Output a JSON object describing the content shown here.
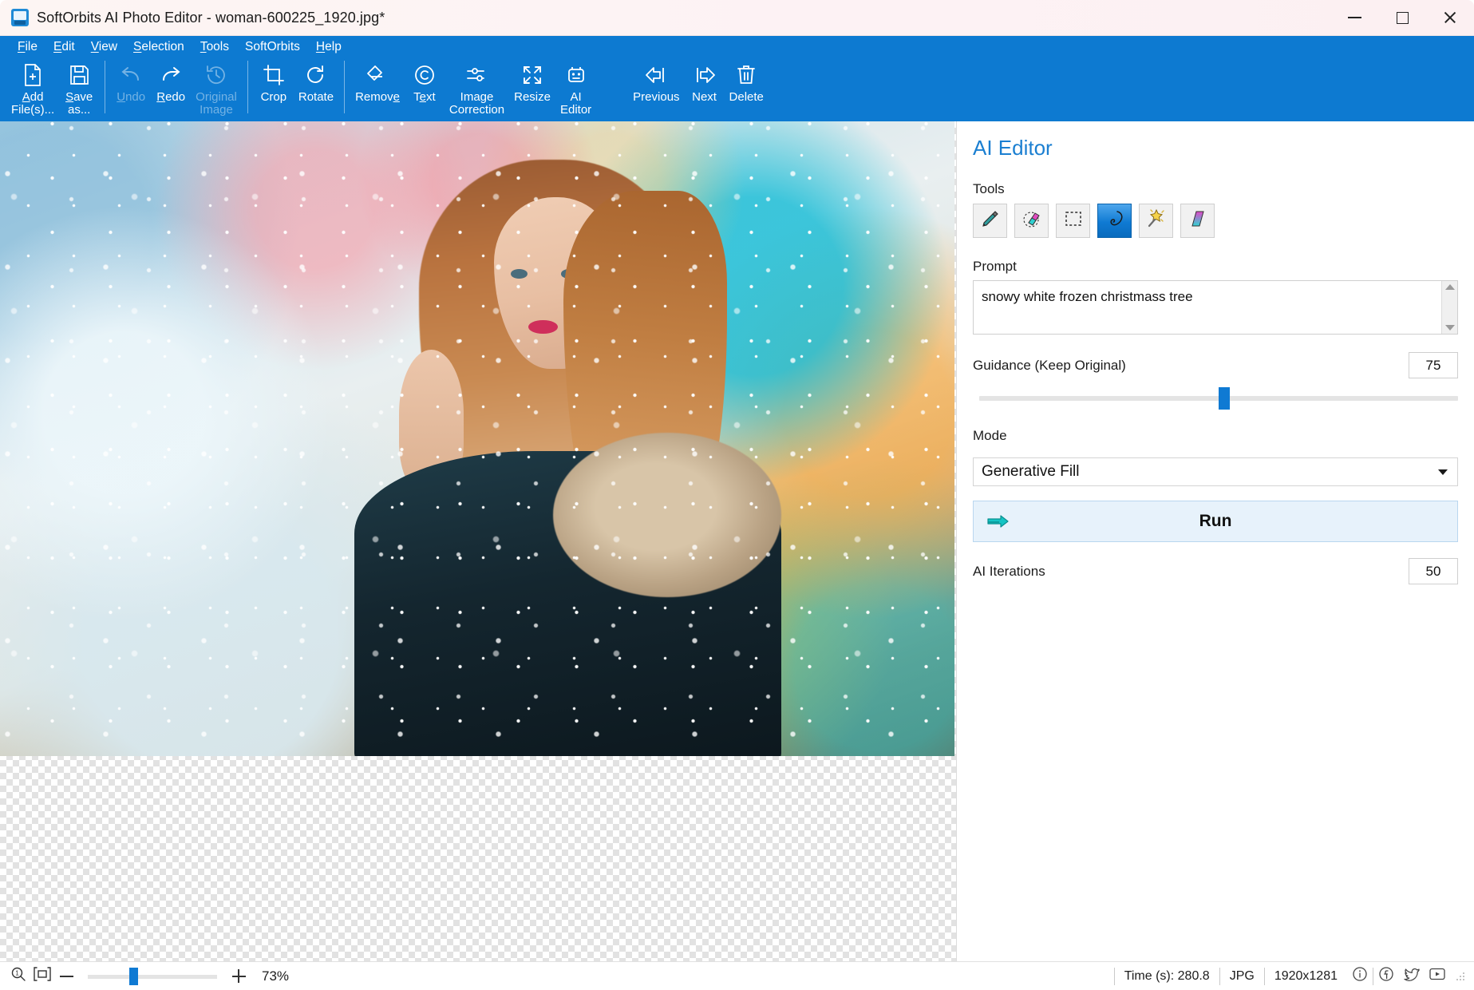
{
  "window": {
    "title": "SoftOrbits AI Photo Editor - woman-600225_1920.jpg*",
    "icon": "app-icon",
    "minimize": "minimize",
    "maximize": "maximize",
    "close": "close"
  },
  "menu": [
    {
      "label": "File",
      "accel": "F"
    },
    {
      "label": "Edit",
      "accel": "E"
    },
    {
      "label": "View",
      "accel": "V"
    },
    {
      "label": "Selection",
      "accel": "S"
    },
    {
      "label": "Tools",
      "accel": "T"
    },
    {
      "label": "SoftOrbits",
      "accel": ""
    },
    {
      "label": "Help",
      "accel": "H"
    }
  ],
  "toolbar": [
    {
      "label": "Add\nFile(s)...",
      "icon": "add-file-icon",
      "disabled": false,
      "accel": "A"
    },
    {
      "label": "Save\nas...",
      "icon": "save-icon",
      "disabled": false,
      "accel": "S"
    },
    {
      "label": "Undo",
      "icon": "undo-icon",
      "disabled": true,
      "accel": "U"
    },
    {
      "label": "Redo",
      "icon": "redo-icon",
      "disabled": false,
      "accel": "R"
    },
    {
      "label": "Original\nImage",
      "icon": "history-icon",
      "disabled": true,
      "accel": ""
    },
    {
      "label": "Crop",
      "icon": "crop-icon",
      "disabled": false,
      "accel": ""
    },
    {
      "label": "Rotate",
      "icon": "rotate-icon",
      "disabled": false,
      "accel": ""
    },
    {
      "label": "Remove",
      "icon": "eraser-icon",
      "disabled": false,
      "accel": "e"
    },
    {
      "label": "Text",
      "icon": "copyright-icon",
      "disabled": false,
      "accel": "e"
    },
    {
      "label": "Image\nCorrection",
      "icon": "sliders-icon",
      "disabled": false,
      "accel": ""
    },
    {
      "label": "Resize",
      "icon": "expand-icon",
      "disabled": false,
      "accel": ""
    },
    {
      "label": "AI\nEditor",
      "icon": "robot-icon",
      "disabled": false,
      "accel": ""
    },
    {
      "label": "Previous",
      "icon": "arrow-left-icon",
      "disabled": false,
      "accel": ""
    },
    {
      "label": "Next",
      "icon": "arrow-right-icon",
      "disabled": false,
      "accel": ""
    },
    {
      "label": "Delete",
      "icon": "trash-icon",
      "disabled": false,
      "accel": ""
    }
  ],
  "panel": {
    "title": "AI Editor",
    "tools_label": "Tools",
    "tools": [
      {
        "name": "marker-tool",
        "icon": "marker-icon",
        "active": false
      },
      {
        "name": "eraser-tool",
        "icon": "eraser-color-icon",
        "active": false
      },
      {
        "name": "rectangle-select-tool",
        "icon": "rectangle-select-icon",
        "active": false
      },
      {
        "name": "lasso-select-tool",
        "icon": "lasso-icon",
        "active": true
      },
      {
        "name": "magic-wand-tool",
        "icon": "magic-wand-icon",
        "active": false
      },
      {
        "name": "gradient-tool",
        "icon": "gradient-icon",
        "active": false
      }
    ],
    "prompt_label": "Prompt",
    "prompt_value": "snowy white frozen christmass tree",
    "guidance_label": "Guidance (Keep Original)",
    "guidance_value": "75",
    "mode_label": "Mode",
    "mode_value": "Generative Fill",
    "run_label": "Run",
    "iterations_label": "AI Iterations",
    "iterations_value": "50"
  },
  "statusbar": {
    "zoom_100_icon": "zoom-actual-size-icon",
    "fit_icon": "fit-to-window-icon",
    "zoom_out_icon": "zoom-out-icon",
    "zoom_in_icon": "zoom-in-icon",
    "zoom_percent": "73%",
    "time": "Time (s): 280.8",
    "format": "JPG",
    "dimensions": "1920x1281",
    "info_icon": "info-icon",
    "facebook_icon": "facebook-icon",
    "twitter_icon": "twitter-icon",
    "youtube_icon": "youtube-icon"
  },
  "colors": {
    "accent": "#0d7ad1",
    "panel_title": "#1b7fd1",
    "run_bg": "#e7f2fb",
    "slider_thumb": "#0f7ad3"
  }
}
